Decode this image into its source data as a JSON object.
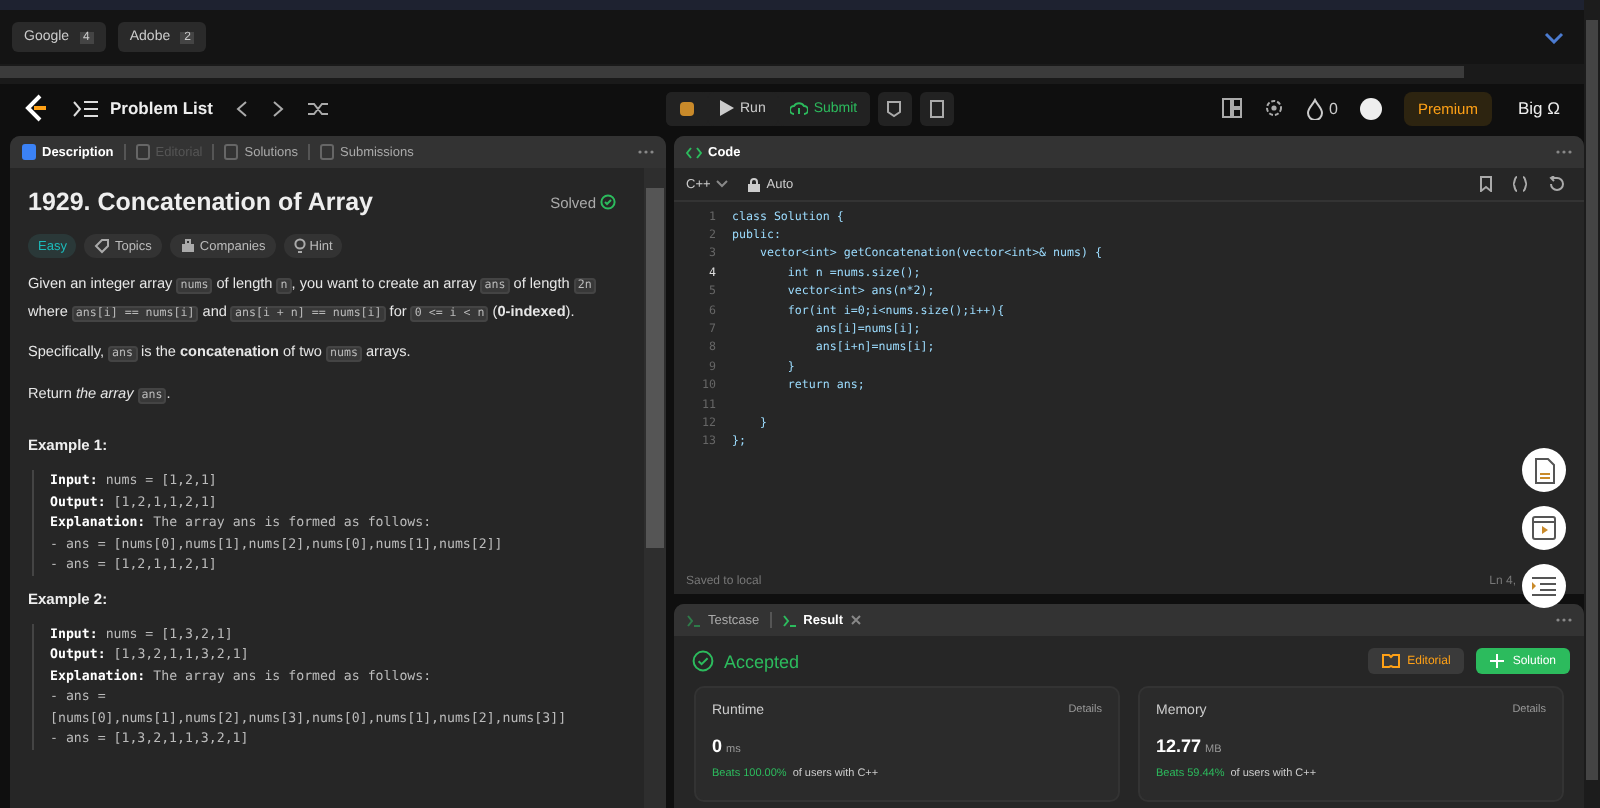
{
  "company_tags": [
    {
      "name": "Google",
      "count": "4"
    },
    {
      "name": "Adobe",
      "count": "2"
    }
  ],
  "navbar": {
    "problem_list": "Problem List",
    "run": "Run",
    "submit": "Submit",
    "streak": "0",
    "premium": "Premium",
    "user": "Big Ω"
  },
  "description_panel": {
    "tabs": [
      {
        "label": "Description",
        "selected": true,
        "disabled": false
      },
      {
        "label": "Editorial",
        "selected": false,
        "disabled": true
      },
      {
        "label": "Solutions",
        "selected": false,
        "disabled": false
      },
      {
        "label": "Submissions",
        "selected": false,
        "disabled": false
      }
    ],
    "title": "1929. Concatenation of Array",
    "status": "Solved",
    "tags": [
      {
        "label": "Easy",
        "kind": "difficulty"
      },
      {
        "label": "Topics",
        "kind": "topics"
      },
      {
        "label": "Companies",
        "kind": "companies"
      },
      {
        "label": "Hint",
        "kind": "hint"
      }
    ],
    "paragraphs": [
      [
        {
          "kind": "text",
          "t": "Given an integer array "
        },
        {
          "kind": "code",
          "t": "nums"
        },
        {
          "kind": "text",
          "t": " of length "
        },
        {
          "kind": "code",
          "t": "n"
        },
        {
          "kind": "text",
          "t": ", you want to create an array "
        },
        {
          "kind": "code",
          "t": "ans"
        },
        {
          "kind": "text",
          "t": " of length "
        },
        {
          "kind": "code",
          "t": "2n"
        },
        {
          "kind": "text",
          "t": " where "
        },
        {
          "kind": "code",
          "t": "ans[i] == nums[i]"
        },
        {
          "kind": "text",
          "t": " and "
        },
        {
          "kind": "code",
          "t": "ans[i + n] == nums[i]"
        },
        {
          "kind": "text",
          "t": " for "
        },
        {
          "kind": "code",
          "t": "0 <= i < n"
        },
        {
          "kind": "text",
          "t": " (**0-indexed**)."
        }
      ],
      [
        {
          "kind": "text",
          "t": "Specifically, "
        },
        {
          "kind": "code",
          "t": "ans"
        },
        {
          "kind": "text",
          "t": " is the **concatenation** of two "
        },
        {
          "kind": "code",
          "t": "nums"
        },
        {
          "kind": "text",
          "t": " arrays."
        }
      ],
      [
        {
          "kind": "text",
          "t": "Return *the array* "
        },
        {
          "kind": "code",
          "t": "ans"
        },
        {
          "kind": "text",
          "t": "."
        }
      ]
    ],
    "examples": [
      {
        "title": "Example 1:",
        "lines": [
          {
            "label": "Input:",
            "text": "nums = [1,2,1]"
          },
          {
            "label": "Output:",
            "text": "[1,2,1,1,2,1]"
          },
          {
            "label": "Explanation:",
            "text": "The array ans is formed as follows:"
          },
          {
            "text": "- ans = [nums[0],nums[1],nums[2],nums[0],nums[1],nums[2]]"
          },
          {
            "text": "- ans = [1,2,1,1,2,1]"
          }
        ]
      },
      {
        "title": "Example 2:",
        "lines": [
          {
            "label": "Input:",
            "text": "nums = [1,3,2,1]"
          },
          {
            "label": "Output:",
            "text": "[1,3,2,1,1,3,2,1]"
          },
          {
            "label": "Explanation:",
            "text": "The array ans is formed as follows:"
          },
          {
            "text": "- ans ="
          },
          {
            "text": "[nums[0],nums[1],nums[2],nums[3],nums[0],nums[1],nums[2],nums[3]]"
          },
          {
            "text": "- ans = [1,3,2,1,1,3,2,1]"
          }
        ]
      }
    ]
  },
  "code_panel": {
    "title": "Code",
    "language": "C++",
    "mode": "Auto",
    "lines": [
      {
        "no": "1",
        "text": "class Solution {",
        "active": false
      },
      {
        "no": "2",
        "text": "public:",
        "active": false
      },
      {
        "no": "3",
        "text": "    vector<int> getConcatenation(vector<int>& nums) {",
        "active": false
      },
      {
        "no": "4",
        "text": "        int n =nums.size();",
        "active": true
      },
      {
        "no": "5",
        "text": "        vector<int> ans(n*2);",
        "active": false
      },
      {
        "no": "6",
        "text": "        for(int i=0;i<nums.size();i++){",
        "active": false
      },
      {
        "no": "7",
        "text": "            ans[i]=nums[i];",
        "active": false
      },
      {
        "no": "8",
        "text": "            ans[i+n]=nums[i];",
        "active": false
      },
      {
        "no": "9",
        "text": "        }",
        "active": false
      },
      {
        "no": "10",
        "text": "        return ans;",
        "active": false
      },
      {
        "no": "11",
        "active": false
      },
      {
        "no": "12",
        "text": "    }",
        "active": false
      },
      {
        "no": "13",
        "text": "};",
        "active": false
      }
    ],
    "saved": "Saved to local",
    "cursor": "Ln 4,"
  },
  "result_panel": {
    "tabs": [
      {
        "label": "Testcase",
        "selected": false
      },
      {
        "label": "Result",
        "selected": true
      }
    ],
    "verdict": "Accepted",
    "editorial": "Editorial",
    "solution": "Solution",
    "cards": [
      {
        "title": "Runtime",
        "details": "Details",
        "value": "0",
        "unit": "ms",
        "beats": "Beats 100.00%",
        "suffix": "of users with C++"
      },
      {
        "title": "Memory",
        "details": "Details",
        "value": "12.77",
        "unit": "MB",
        "beats": "Beats 59.44%",
        "suffix": "of users with C++"
      }
    ]
  }
}
